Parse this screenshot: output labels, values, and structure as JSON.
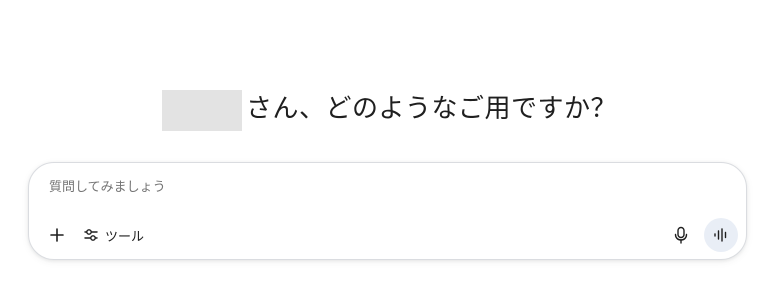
{
  "greeting": {
    "text": "さん、どのようなご用ですか？"
  },
  "composer": {
    "placeholder": "質問してみましょう",
    "add_icon": "plus-icon",
    "tools_icon": "sliders-icon",
    "tools_label": "ツール",
    "mic_icon": "microphone-icon",
    "voice_icon": "audio-waveform-icon"
  },
  "colors": {
    "redaction": "#e3e3e3",
    "voice_button_bg": "#e9eef6",
    "border": "#dadce0",
    "placeholder": "#757575"
  }
}
